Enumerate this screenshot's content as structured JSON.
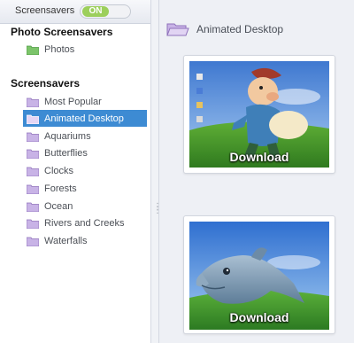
{
  "sidebar": {
    "topbar": {
      "label": "Screensavers",
      "toggle": "ON"
    },
    "photo_section": {
      "title": "Photo Screensavers",
      "items": [
        {
          "label": "Photos"
        }
      ]
    },
    "screensaver_section": {
      "title": "Screensavers",
      "items": [
        {
          "label": "Most Popular",
          "selected": false
        },
        {
          "label": "Animated Desktop",
          "selected": true
        },
        {
          "label": "Aquariums",
          "selected": false
        },
        {
          "label": "Butterflies",
          "selected": false
        },
        {
          "label": "Clocks",
          "selected": false
        },
        {
          "label": "Forests",
          "selected": false
        },
        {
          "label": "Ocean",
          "selected": false
        },
        {
          "label": "Rivers and Creeks",
          "selected": false
        },
        {
          "label": "Waterfalls",
          "selected": false
        }
      ]
    }
  },
  "main": {
    "title": "Animated Desktop",
    "cards": [
      {
        "action": "Download"
      },
      {
        "action": "Download"
      }
    ]
  },
  "colors": {
    "selected": "#3d8bd3",
    "folder_purple": "#b79ad9",
    "folder_green": "#7cc46a",
    "toggle_green": "#9ccf5b"
  }
}
